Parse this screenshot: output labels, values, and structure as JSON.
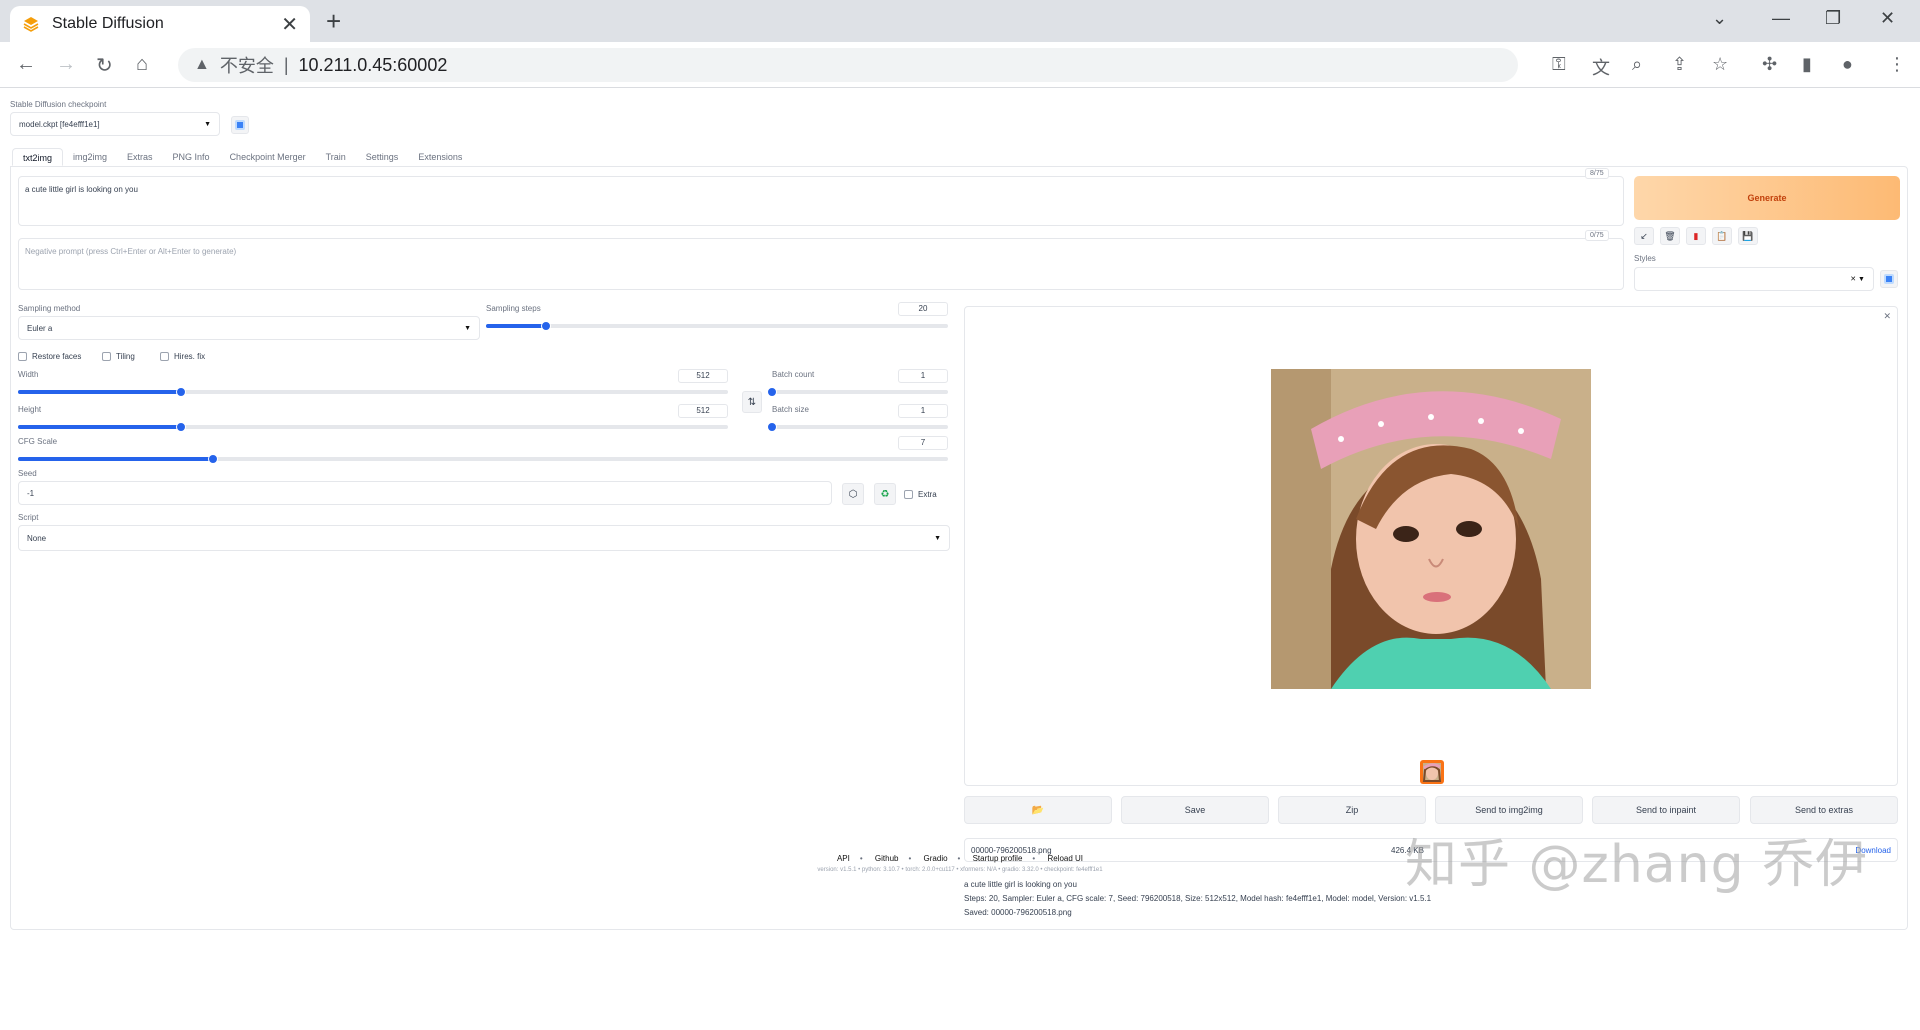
{
  "browser": {
    "tab_title": "Stable Diffusion",
    "insecure_label": "不安全",
    "separator": "|",
    "url": "10.211.0.45:60002"
  },
  "checkpoint": {
    "label": "Stable Diffusion checkpoint",
    "value": "model.ckpt [fe4efff1e1]"
  },
  "tabs": [
    "txt2img",
    "img2img",
    "Extras",
    "PNG Info",
    "Checkpoint Merger",
    "Train",
    "Settings",
    "Extensions"
  ],
  "prompt": {
    "value": "a cute little girl is looking on you",
    "counter": "8/75"
  },
  "negative_prompt": {
    "placeholder": "Negative prompt (press Ctrl+Enter or Alt+Enter to generate)",
    "counter": "0/75"
  },
  "generate_label": "Generate",
  "styles_label": "Styles",
  "sampling": {
    "method_label": "Sampling method",
    "method_value": "Euler a",
    "steps_label": "Sampling steps",
    "steps_value": "20",
    "steps_fraction": 0.13
  },
  "checkboxes": {
    "restore_faces": "Restore faces",
    "tiling": "Tiling",
    "hires_fix": "Hires. fix",
    "extra": "Extra"
  },
  "width": {
    "label": "Width",
    "value": "512",
    "fraction": 0.23
  },
  "height": {
    "label": "Height",
    "value": "512",
    "fraction": 0.23
  },
  "batch_count": {
    "label": "Batch count",
    "value": "1",
    "fraction": 0.0
  },
  "batch_size": {
    "label": "Batch size",
    "value": "1",
    "fraction": 0.0
  },
  "cfg": {
    "label": "CFG Scale",
    "value": "7",
    "fraction": 0.21
  },
  "seed": {
    "label": "Seed",
    "value": "-1"
  },
  "script": {
    "label": "Script",
    "value": "None"
  },
  "actions": [
    "Save",
    "Zip",
    "Send to img2img",
    "Send to inpaint",
    "Send to extras"
  ],
  "file": {
    "name": "00000-796200518.png",
    "size": "426.4 KB",
    "download": "Download"
  },
  "generation_info": {
    "prompt": "a cute little girl is looking on you",
    "params": "Steps: 20, Sampler: Euler a, CFG scale: 7, Seed: 796200518, Size: 512x512, Model hash: fe4efff1e1, Model: model, Version: v1.5.1",
    "saved": "Saved: 00000-796200518.png"
  },
  "footer": {
    "links": [
      "API",
      "Github",
      "Gradio",
      "Startup profile",
      "Reload UI"
    ],
    "version": "version: v1.5.1  •  python: 3.10.7  •  torch: 2.0.0+cu117  •  xformers: N/A  •  gradio: 3.32.0  •  checkpoint: fe4efff1e1"
  },
  "watermark": "知乎 @zhang 乔伊",
  "colors": {
    "accent": "#2563eb",
    "generate_from": "#fed7aa",
    "generate_to": "#fdba74",
    "generate_text": "#c2410c"
  }
}
